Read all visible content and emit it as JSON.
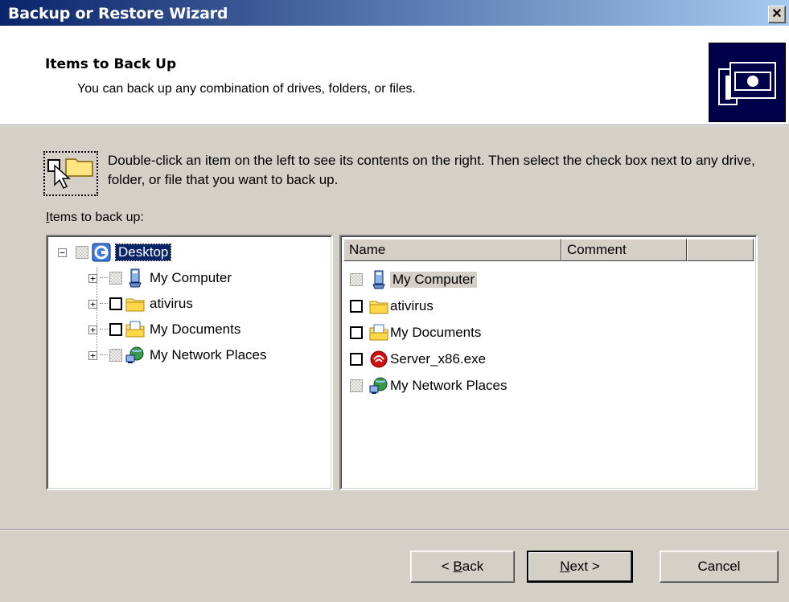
{
  "window": {
    "title": "Backup or Restore Wizard",
    "close_label": "✕"
  },
  "header": {
    "title": "Items to Back Up",
    "subtitle": "You can back up any combination of drives, folders, or files.",
    "icon": "backup-wizard-icon"
  },
  "instructions": {
    "text": "Double-click an item on the left to see its contents on the right. Then select the check box next to any drive, folder, or file that you want to back up.",
    "icon": "checkbox-folder-cursor-icon"
  },
  "tree": {
    "label_prefix": "I",
    "label_rest": "tems to back up:",
    "root": {
      "label": "Desktop",
      "expander": "−",
      "icon": "desktop-icon"
    },
    "items": [
      {
        "label": "My Computer",
        "expander": "+",
        "checkbox": "grey",
        "icon": "computer-icon"
      },
      {
        "label": "ativirus",
        "expander": "+",
        "checkbox": "empty",
        "icon": "folder-icon"
      },
      {
        "label": "My Documents",
        "expander": "+",
        "checkbox": "empty",
        "icon": "documents-icon"
      },
      {
        "label": "My Network Places",
        "expander": "+",
        "checkbox": "grey",
        "icon": "network-icon"
      }
    ]
  },
  "list": {
    "columns": [
      "Name",
      "Comment"
    ],
    "items": [
      {
        "name": "My Computer",
        "checkbox": "grey",
        "icon": "computer-icon"
      },
      {
        "name": "ativirus",
        "checkbox": "empty",
        "icon": "folder-icon"
      },
      {
        "name": "My Documents",
        "checkbox": "empty",
        "icon": "documents-icon"
      },
      {
        "name": "Server_x86.exe",
        "checkbox": "empty",
        "icon": "exe-icon"
      },
      {
        "name": "My Network Places",
        "checkbox": "grey",
        "icon": "network-icon"
      }
    ]
  },
  "buttons": {
    "back_prefix": "< ",
    "back_accel": "B",
    "back_rest": "ack",
    "next_accel": "N",
    "next_rest": "ext >",
    "cancel": "Cancel"
  },
  "colors": {
    "titlebar_start": "#0a246a",
    "titlebar_end": "#a6caf0",
    "face": "#d4d0c8",
    "selection": "#0a246a"
  }
}
